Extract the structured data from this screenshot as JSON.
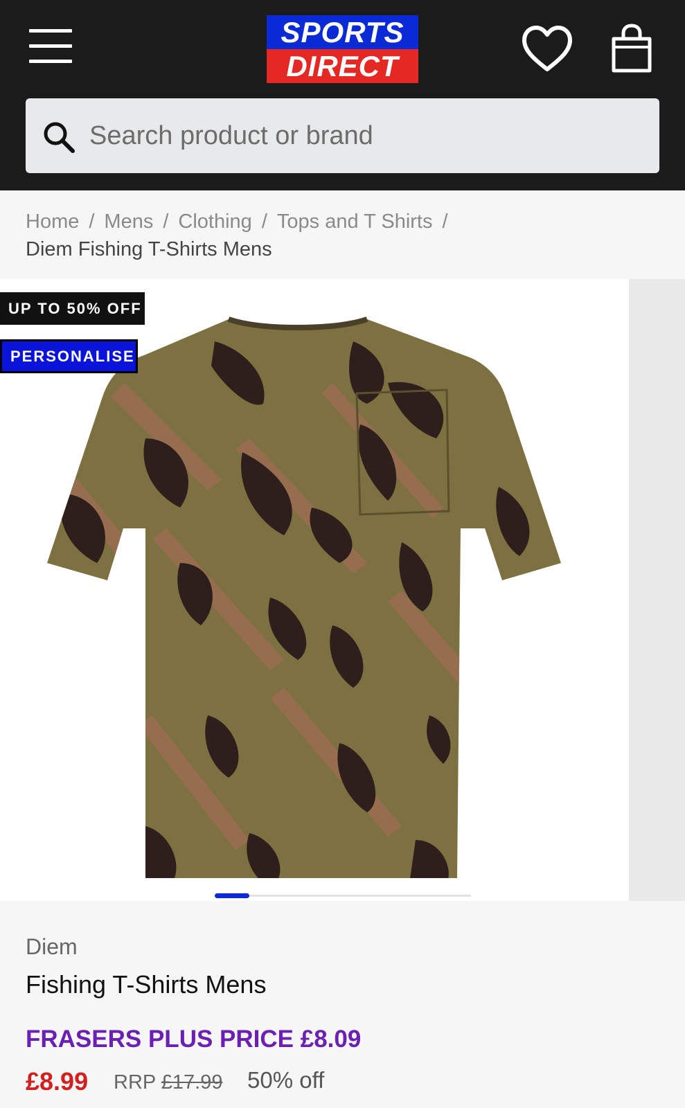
{
  "header": {
    "logo_top": "SPORTS",
    "logo_bottom": "DIRECT",
    "menu_icon": "hamburger-menu-icon",
    "wishlist_icon": "heart-icon",
    "bag_icon": "shopping-bag-icon",
    "colors": {
      "background": "#1b1b1b",
      "logo_blue": "#0a2ad6",
      "logo_red": "#e42824"
    }
  },
  "search": {
    "placeholder": "Search product or brand",
    "value": "",
    "icon": "search-icon"
  },
  "breadcrumb": {
    "items": [
      "Home",
      "Mens",
      "Clothing",
      "Tops and T Shirts"
    ],
    "separator": "/",
    "current": "Diem Fishing T-Shirts Mens"
  },
  "gallery": {
    "badges": {
      "offer": "UP TO 50% OFF",
      "personalise": "PERSONALISE"
    },
    "image_description_icon": "camo-tshirt-image",
    "active_slide": 1
  },
  "product": {
    "brand": "Diem",
    "name": "Fishing T-Shirts Mens",
    "frasers_plus_price": "FRASERS PLUS PRICE £8.09",
    "price": "£8.99",
    "rrp_label": "RRP",
    "rrp_value": "£17.99",
    "discount": "50% off",
    "colors": {
      "price": "#d12020",
      "plus_price": "#6b1fb3"
    }
  }
}
